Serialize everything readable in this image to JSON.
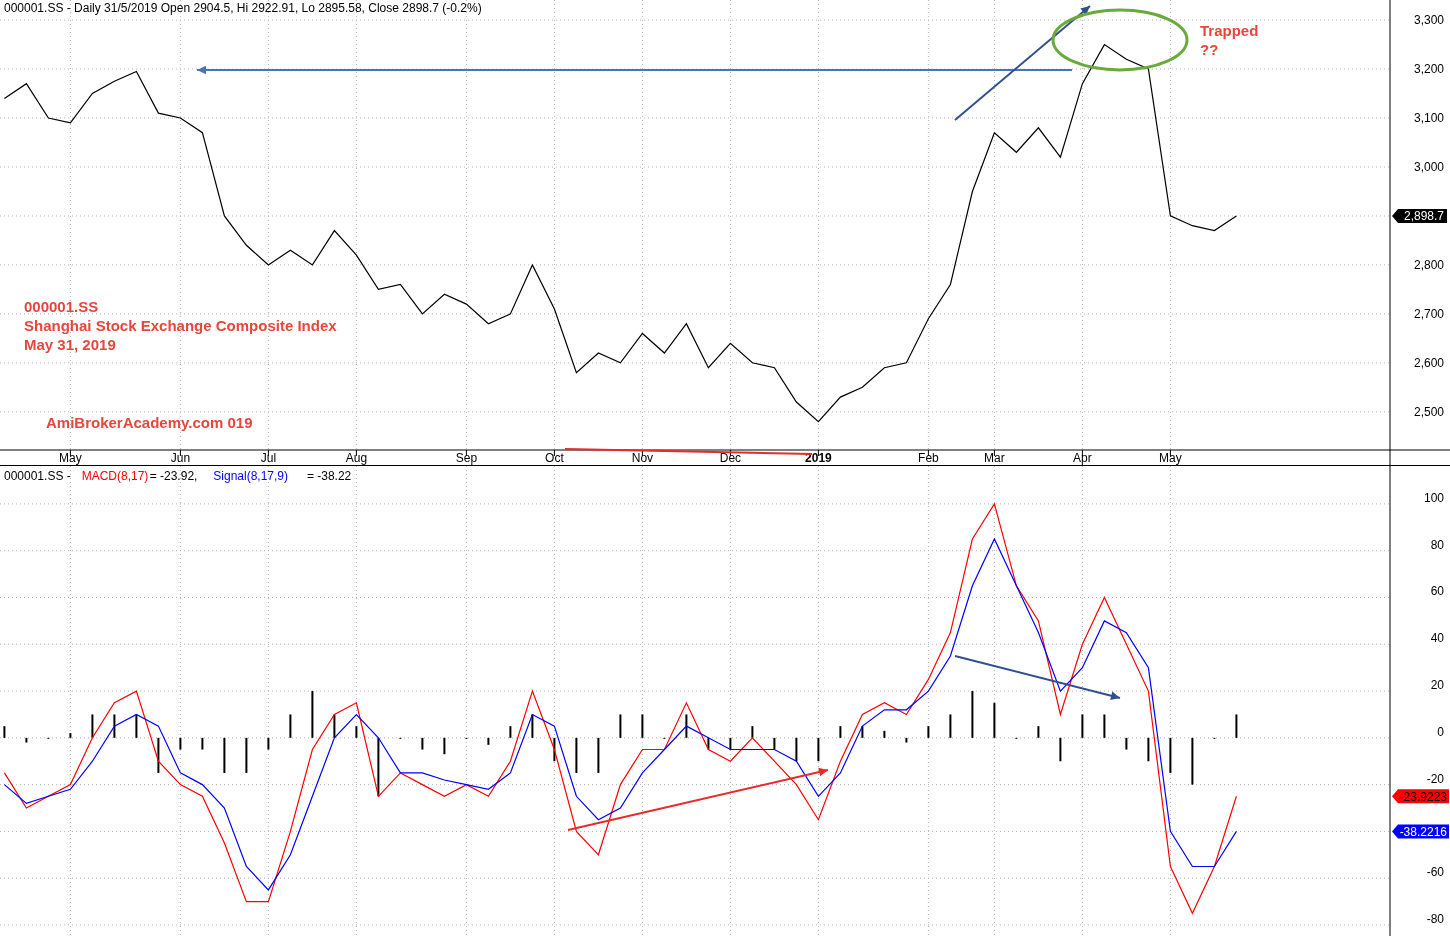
{
  "price_pane": {
    "legend": "000001.SS - Daily 31/5/2019 Open 2904.5, Hi 2922.91, Lo 2895.58, Close 2898.7 (-0.2%)",
    "value_tag": {
      "text": "2,898.7",
      "color": "#000000"
    },
    "notes": [
      {
        "text": "000001.SS"
      },
      {
        "text": "Shanghai Stock Exchange Composite Index"
      },
      {
        "text": "May 31, 2019"
      },
      {
        "text": "AmiBrokerAcademy.com  019"
      },
      {
        "text": "Trapped"
      },
      {
        "text": "??"
      }
    ],
    "chart_data": {
      "type": "line",
      "categories": [
        null,
        null,
        null,
        "May",
        null,
        null,
        null,
        null,
        "Jun",
        null,
        null,
        null,
        "Jul",
        null,
        null,
        null,
        "Aug",
        null,
        null,
        null,
        null,
        "Sep",
        null,
        null,
        null,
        "Oct",
        null,
        null,
        null,
        "Nov",
        null,
        null,
        null,
        "Dec",
        null,
        null,
        null,
        "2019",
        null,
        null,
        null,
        null,
        "Feb",
        null,
        null,
        "Mar",
        null,
        null,
        null,
        "Apr",
        null,
        null,
        null,
        "May",
        null,
        null,
        null
      ],
      "series": [
        {
          "color": "#000000",
          "values": [
            3140,
            3170,
            3100,
            3090,
            3150,
            3175,
            3195,
            3110,
            3100,
            3070,
            2900,
            2840,
            2800,
            2830,
            2800,
            2870,
            2820,
            2750,
            2760,
            2700,
            2740,
            2720,
            2680,
            2700,
            2800,
            2710,
            2580,
            2620,
            2600,
            2660,
            2620,
            2680,
            2590,
            2640,
            2600,
            2590,
            2520,
            2480,
            2530,
            2550,
            2590,
            2600,
            2690,
            2760,
            2950,
            3070,
            3030,
            3080,
            3020,
            3170,
            3250,
            3220,
            3200,
            2900,
            2880,
            2870,
            2900
          ]
        }
      ],
      "grid": true,
      "ylim": [
        2422,
        3341
      ],
      "yticks": [
        {
          "value": 2500,
          "label": "2,500"
        },
        {
          "value": 2600,
          "label": "2,600"
        },
        {
          "value": 2700,
          "label": "2,700"
        },
        {
          "value": 2800,
          "label": "2,800"
        },
        {
          "value": 3000,
          "label": "3,000"
        },
        {
          "value": 3100,
          "label": "3,100"
        },
        {
          "value": 3200,
          "label": "3,200"
        },
        {
          "value": 3300,
          "label": "3,300"
        }
      ]
    }
  },
  "macd_pane": {
    "legend": {
      "ticker": "000001.SS -",
      "items": [
        {
          "value": "= -23.92,"
        },
        {
          "value": "= -38.22"
        }
      ]
    },
    "value_tags": [
      {
        "text": "-23.9223",
        "color": "#ff0000"
      },
      {
        "text": "-38.2216",
        "color": "#0000ff"
      }
    ],
    "chart_data": {
      "type": "line",
      "series": [
        {
          "name": "MACD(8,17)",
          "color": "#ff0000",
          "values": [
            -15,
            -30,
            -25,
            -20,
            0,
            15,
            20,
            -10,
            -20,
            -25,
            -45,
            -70,
            -70,
            -40,
            -5,
            10,
            15,
            -25,
            -15,
            -20,
            -25,
            -20,
            -25,
            -10,
            20,
            -5,
            -40,
            -50,
            -20,
            -5,
            -5,
            15,
            -5,
            -10,
            0,
            -10,
            -20,
            -35,
            -10,
            10,
            15,
            10,
            25,
            45,
            85,
            100,
            65,
            50,
            10,
            40,
            60,
            40,
            20,
            -55,
            -75,
            -55,
            -25
          ]
        },
        {
          "name": "Signal(8,17,9)",
          "color": "#0000ff",
          "values": [
            -20,
            -28,
            -25,
            -22,
            -10,
            5,
            10,
            5,
            -15,
            -20,
            -30,
            -55,
            -65,
            -50,
            -25,
            0,
            10,
            0,
            -15,
            -15,
            -18,
            -20,
            -22,
            -15,
            10,
            5,
            -25,
            -35,
            -30,
            -15,
            -5,
            5,
            0,
            -5,
            -5,
            -5,
            -10,
            -25,
            -15,
            5,
            12,
            12,
            20,
            35,
            65,
            85,
            65,
            45,
            20,
            30,
            50,
            45,
            30,
            -40,
            -55,
            -55,
            -40
          ]
        },
        {
          "type": "bar",
          "color": "#000000",
          "values": [
            5,
            -2,
            0,
            2,
            10,
            10,
            10,
            -15,
            -5,
            -5,
            -15,
            -15,
            -5,
            10,
            20,
            10,
            5,
            -25,
            0,
            -5,
            -7,
            0,
            -3,
            5,
            10,
            -10,
            -15,
            -15,
            10,
            10,
            0,
            10,
            -5,
            -5,
            5,
            -5,
            -10,
            -10,
            5,
            5,
            3,
            -2,
            5,
            10,
            20,
            15,
            0,
            5,
            -10,
            10,
            10,
            -5,
            -10,
            -15,
            -20,
            0,
            10
          ]
        }
      ],
      "grid": true,
      "ylim": [
        -84.7,
        116.2
      ],
      "yticks": [
        {
          "value": -80,
          "label": "-80"
        },
        {
          "value": -60,
          "label": "-60"
        },
        {
          "value": -20,
          "label": "-20"
        },
        {
          "value": 0,
          "label": "0"
        },
        {
          "value": 20,
          "label": "20"
        },
        {
          "value": 40,
          "label": "40"
        },
        {
          "value": 60,
          "label": "60"
        },
        {
          "value": 80,
          "label": "80"
        },
        {
          "value": 100,
          "label": "100"
        }
      ]
    }
  }
}
